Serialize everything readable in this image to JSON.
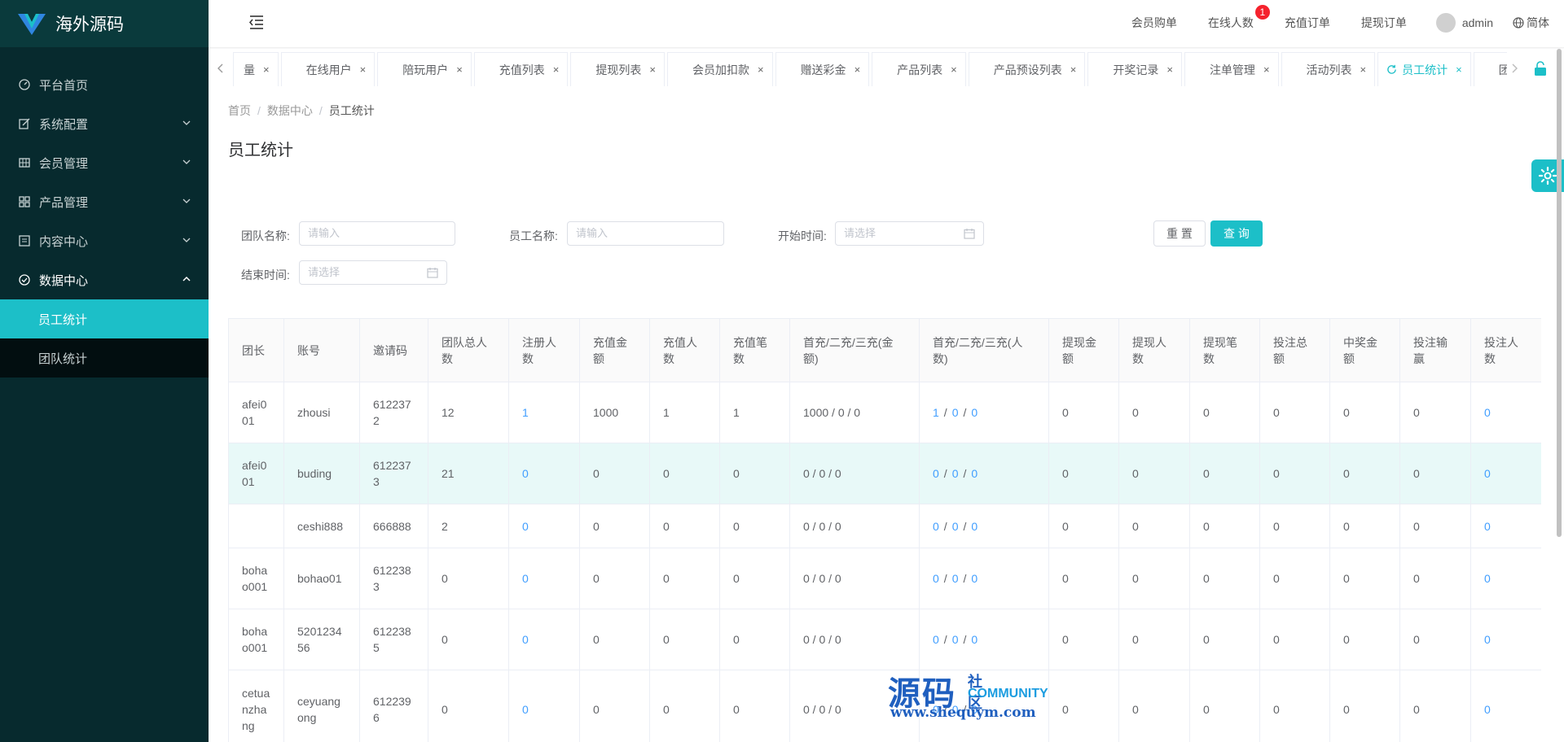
{
  "app": {
    "title": "海外源码"
  },
  "sidebar": {
    "items": [
      {
        "label": "平台首页",
        "icon": "dashboard-icon",
        "expandable": false
      },
      {
        "label": "系统配置",
        "icon": "edit-icon",
        "expandable": true
      },
      {
        "label": "会员管理",
        "icon": "grid-icon",
        "expandable": true
      },
      {
        "label": "产品管理",
        "icon": "apps-icon",
        "expandable": true
      },
      {
        "label": "内容中心",
        "icon": "document-icon",
        "expandable": true
      },
      {
        "label": "数据中心",
        "icon": "check-circle-icon",
        "expandable": true,
        "open": true
      }
    ],
    "submenu": [
      {
        "label": "员工统计",
        "active": true
      },
      {
        "label": "团队统计",
        "active": false
      }
    ]
  },
  "header": {
    "links": [
      "会员购单",
      "在线人数",
      "充值订单",
      "提现订单"
    ],
    "online_badge": "1",
    "user": "admin",
    "language": "简体"
  },
  "tabs": [
    {
      "label": "量"
    },
    {
      "label": "在线用户"
    },
    {
      "label": "陪玩用户"
    },
    {
      "label": "充值列表"
    },
    {
      "label": "提现列表"
    },
    {
      "label": "会员加扣款"
    },
    {
      "label": "赠送彩金"
    },
    {
      "label": "产品列表"
    },
    {
      "label": "产品预设列表"
    },
    {
      "label": "开奖记录"
    },
    {
      "label": "注单管理"
    },
    {
      "label": "活动列表"
    },
    {
      "label": "员工统计",
      "active": true
    },
    {
      "label": "团队统计"
    }
  ],
  "breadcrumb": {
    "home": "首页",
    "section": "数据中心",
    "current": "员工统计"
  },
  "page_title": "员工统计",
  "filters": {
    "team_label": "团队名称:",
    "team_placeholder": "请输入",
    "staff_label": "员工名称:",
    "staff_placeholder": "请输入",
    "start_label": "开始时间:",
    "start_placeholder": "请选择",
    "end_label": "结束时间:",
    "end_placeholder": "请选择",
    "reset": "重 置",
    "query": "查 询"
  },
  "table": {
    "columns": [
      "团长",
      "账号",
      "邀请码",
      "团队总人数",
      "注册人数",
      "充值金额",
      "充值人数",
      "充值笔数",
      "首充/二充/三充(金额)",
      "首充/二充/三充(人数)",
      "提现金额",
      "提现人数",
      "提现笔数",
      "投注总额",
      "中奖金额",
      "投注输赢",
      "投注人数"
    ],
    "rows": [
      {
        "leader": "afei001",
        "account": "zhousi",
        "invite": "6122372",
        "team_total": "12",
        "registered": "1",
        "recharge_amount": "1000",
        "recharge_users": "1",
        "recharge_count": "1",
        "first_amount": "1000 / 0 / 0",
        "first_users_1": "1",
        "first_users_2": "0",
        "first_users_3": "0",
        "withdraw_amount": "0",
        "withdraw_users": "0",
        "withdraw_count": "0",
        "bet_total": "0",
        "win_amount": "0",
        "bet_result": "0",
        "bet_users": "0"
      },
      {
        "leader": "afei001",
        "account": "buding",
        "invite": "6122373",
        "team_total": "21",
        "registered": "0",
        "recharge_amount": "0",
        "recharge_users": "0",
        "recharge_count": "0",
        "first_amount": "0 / 0 / 0",
        "first_users_1": "0",
        "first_users_2": "0",
        "first_users_3": "0",
        "withdraw_amount": "0",
        "withdraw_users": "0",
        "withdraw_count": "0",
        "bet_total": "0",
        "win_amount": "0",
        "bet_result": "0",
        "bet_users": "0",
        "highlight": true
      },
      {
        "leader": "",
        "account": "ceshi888",
        "invite": "666888",
        "team_total": "2",
        "registered": "0",
        "recharge_amount": "0",
        "recharge_users": "0",
        "recharge_count": "0",
        "first_amount": "0 / 0 / 0",
        "first_users_1": "0",
        "first_users_2": "0",
        "first_users_3": "0",
        "withdraw_amount": "0",
        "withdraw_users": "0",
        "withdraw_count": "0",
        "bet_total": "0",
        "win_amount": "0",
        "bet_result": "0",
        "bet_users": "0"
      },
      {
        "leader": "bohao001",
        "account": "bohao01",
        "invite": "6122383",
        "team_total": "0",
        "registered": "0",
        "recharge_amount": "0",
        "recharge_users": "0",
        "recharge_count": "0",
        "first_amount": "0 / 0 / 0",
        "first_users_1": "0",
        "first_users_2": "0",
        "first_users_3": "0",
        "withdraw_amount": "0",
        "withdraw_users": "0",
        "withdraw_count": "0",
        "bet_total": "0",
        "win_amount": "0",
        "bet_result": "0",
        "bet_users": "0"
      },
      {
        "leader": "bohao001",
        "account": "520123456",
        "invite": "6122385",
        "team_total": "0",
        "registered": "0",
        "recharge_amount": "0",
        "recharge_users": "0",
        "recharge_count": "0",
        "first_amount": "0 / 0 / 0",
        "first_users_1": "0",
        "first_users_2": "0",
        "first_users_3": "0",
        "withdraw_amount": "0",
        "withdraw_users": "0",
        "withdraw_count": "0",
        "bet_total": "0",
        "win_amount": "0",
        "bet_result": "0",
        "bet_users": "0"
      },
      {
        "leader": "cetuanzhang",
        "account": "ceyuangong",
        "invite": "6122396",
        "team_total": "0",
        "registered": "0",
        "recharge_amount": "0",
        "recharge_users": "0",
        "recharge_count": "0",
        "first_amount": "0 / 0 / 0",
        "first_users_1": "0",
        "first_users_2": "0",
        "first_users_3": "0",
        "withdraw_amount": "0",
        "withdraw_users": "0",
        "withdraw_count": "0",
        "bet_total": "0",
        "win_amount": "0",
        "bet_result": "0",
        "bet_users": "0"
      }
    ]
  },
  "watermark": {
    "big": "源码",
    "small1": "社区",
    "small2": "COMMUNITY",
    "url": "www.shequym.com"
  },
  "colors": {
    "accent": "#1cbfc8",
    "sidebar": "#072a2e",
    "link": "#409eff",
    "badge": "#f5222d"
  }
}
